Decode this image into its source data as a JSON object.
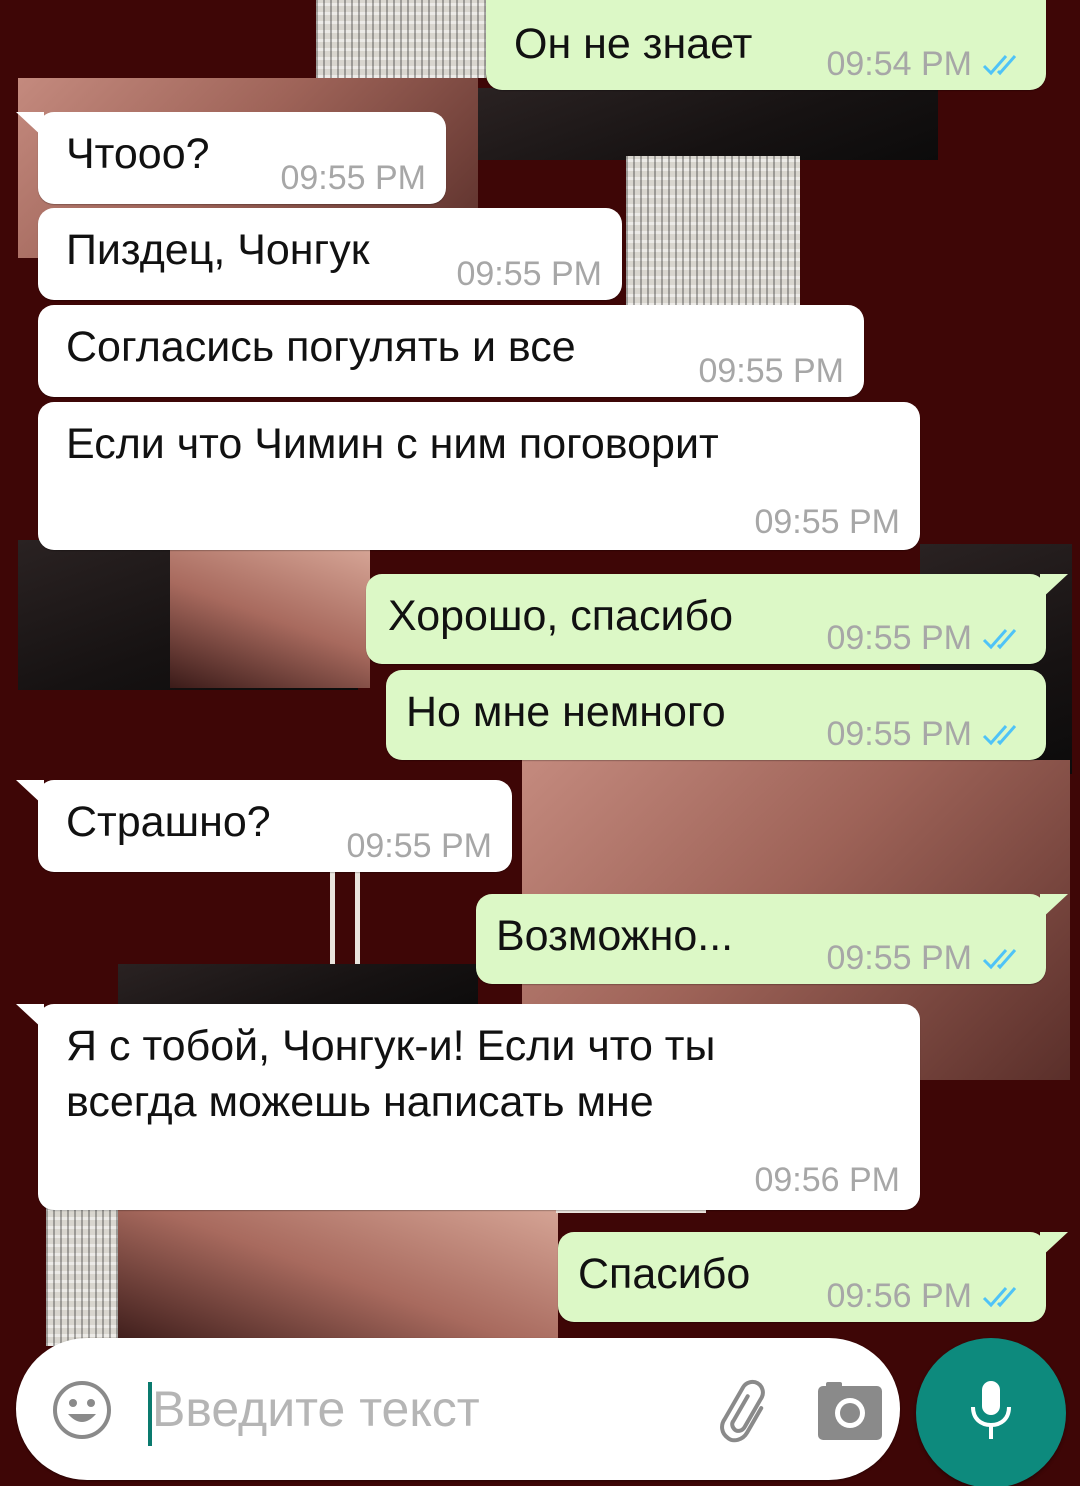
{
  "colors": {
    "incoming_bubble": "#ffffff",
    "outgoing_bubble": "#dcf8c6",
    "timestamp": "#a7a7a7",
    "read_ticks": "#4fc3f7",
    "mic_button": "#0d8a7d",
    "wallpaper_base": "#3e0606"
  },
  "messages": [
    {
      "direction": "outgoing",
      "text": "Он не знает",
      "time": "09:54 PM",
      "status": "read"
    },
    {
      "direction": "incoming",
      "text": "Чтооо?",
      "time": "09:55 PM"
    },
    {
      "direction": "incoming",
      "text": "Пиздец, Чонгук",
      "time": "09:55 PM"
    },
    {
      "direction": "incoming",
      "text": "Согласись погулять и все",
      "time": "09:55 PM"
    },
    {
      "direction": "incoming",
      "text": "Если что Чимин с ним поговорит",
      "time": "09:55 PM"
    },
    {
      "direction": "outgoing",
      "text": "Хорошо, спасибо",
      "time": "09:55 PM",
      "status": "read"
    },
    {
      "direction": "outgoing",
      "text": "Но мне немного",
      "time": "09:55 PM",
      "status": "read"
    },
    {
      "direction": "incoming",
      "text": "Страшно?",
      "time": "09:55 PM"
    },
    {
      "direction": "outgoing",
      "text": "Возможно...",
      "time": "09:55 PM",
      "status": "read"
    },
    {
      "direction": "incoming",
      "text": "Я с тобой, Чонгук-и! Если что ты всегда можешь написать мне",
      "time": "09:56 PM"
    },
    {
      "direction": "outgoing",
      "text": "Спасибо",
      "time": "09:56 PM",
      "status": "read"
    }
  ],
  "input": {
    "placeholder": "Введите текст",
    "value": "",
    "emoji_icon": "smiley-icon",
    "attach_icon": "paperclip-icon",
    "camera_icon": "camera-icon",
    "mic_icon": "microphone-icon"
  }
}
